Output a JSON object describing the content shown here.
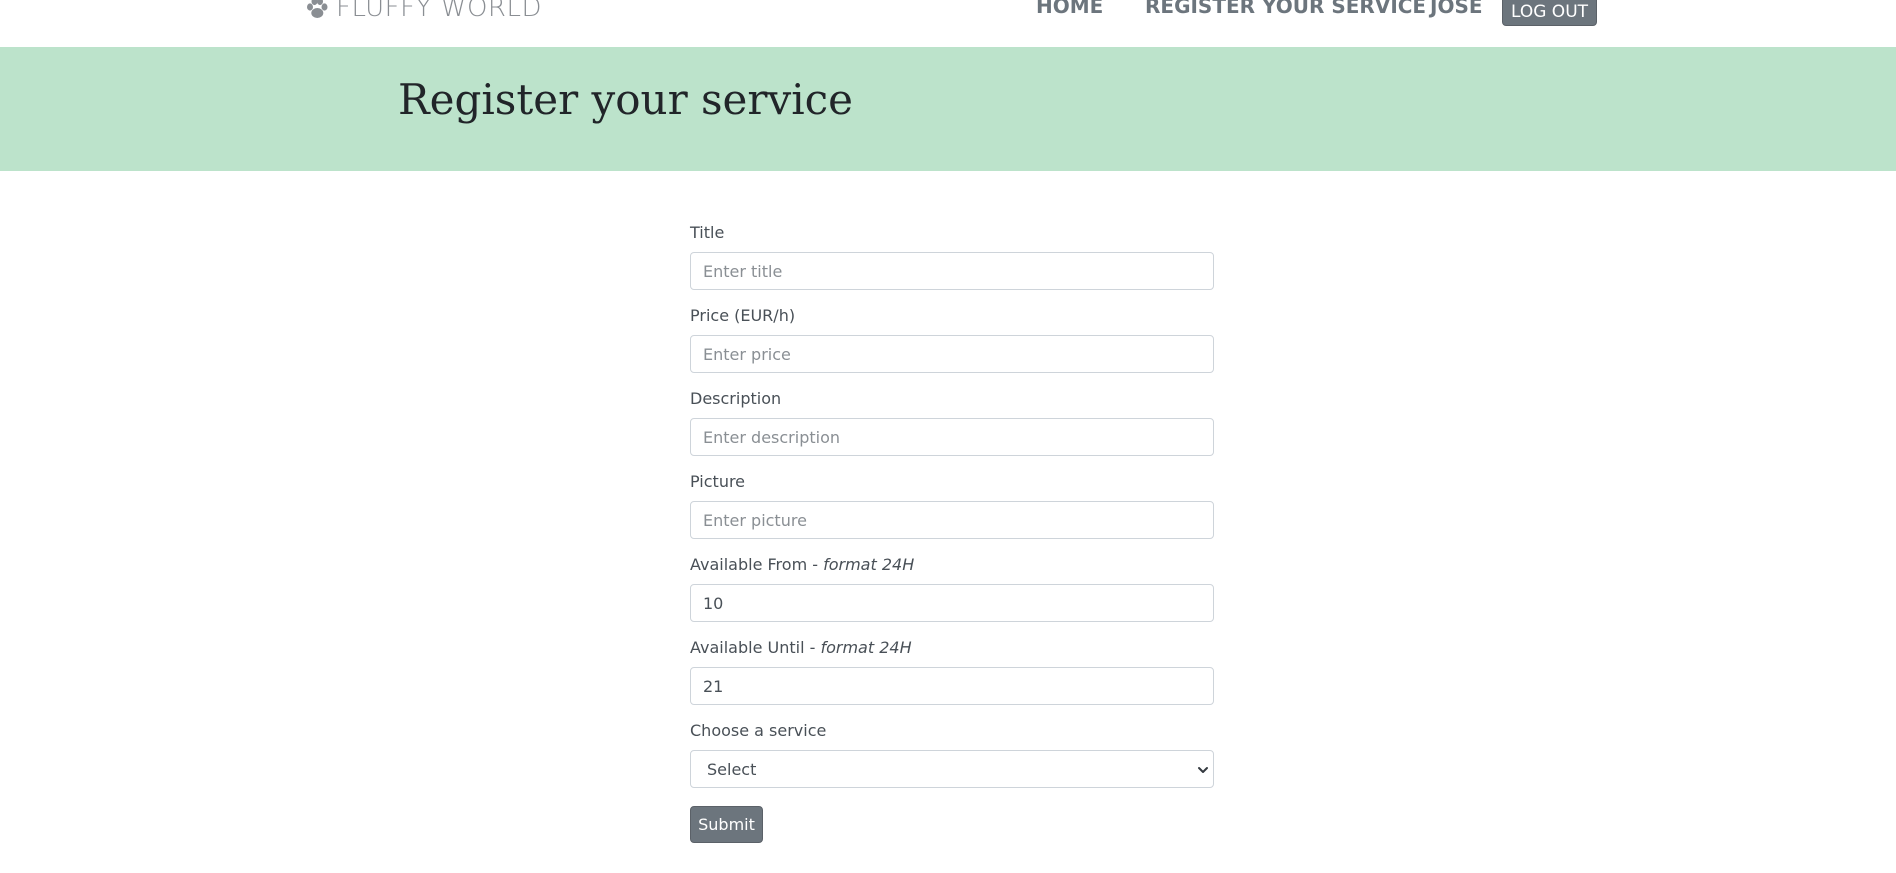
{
  "navbar": {
    "brand": "FLUFFY WORLD",
    "brand_icon": "paw-icon",
    "links": [
      {
        "label": "HOME"
      },
      {
        "label": "REGISTER YOUR SERVICE"
      },
      {
        "label": "JOSE"
      }
    ],
    "logout_label": "LOG OUT"
  },
  "hero": {
    "title": "Register your service",
    "background_color": "#bce3cb"
  },
  "form": {
    "title": {
      "label": "Title",
      "placeholder": "Enter title",
      "value": ""
    },
    "price": {
      "label": "Price (EUR/h)",
      "placeholder": "Enter price",
      "value": ""
    },
    "description": {
      "label": "Description",
      "placeholder": "Enter description",
      "value": ""
    },
    "picture": {
      "label": "Picture",
      "placeholder": "Enter picture",
      "value": ""
    },
    "available_from": {
      "label": "Available From - ",
      "label_note": "format 24H",
      "value": "10"
    },
    "available_until": {
      "label": "Available Until - ",
      "label_note": "format 24H",
      "value": "21"
    },
    "service": {
      "label": "Choose a service",
      "selected": "Select"
    },
    "submit_label": "Submit"
  },
  "colors": {
    "button": "#6c757d",
    "hero": "#bce3cb"
  }
}
